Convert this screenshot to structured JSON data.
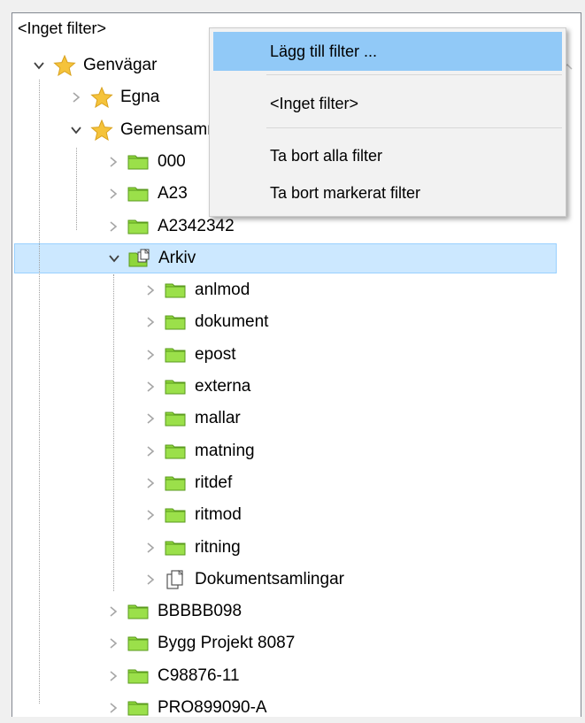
{
  "filter_label": "<Inget filter>",
  "tree": {
    "rows": [
      {
        "label": "Genvägar",
        "icon": "star-icon",
        "expanded": true
      },
      {
        "label": "Egna",
        "icon": "star-icon",
        "expanded": false
      },
      {
        "label": "Gemensamma",
        "icon": "star-icon",
        "expanded": true
      },
      {
        "label": "000",
        "icon": "folder-icon",
        "expanded": false
      },
      {
        "label": "A23",
        "icon": "folder-icon",
        "expanded": false
      },
      {
        "label": "A2342342",
        "icon": "folder-icon",
        "expanded": false
      },
      {
        "label": "Arkiv",
        "icon": "archive-folder-icon",
        "expanded": true,
        "selected": true
      },
      {
        "label": "anlmod",
        "icon": "folder-icon",
        "expanded": false
      },
      {
        "label": "dokument",
        "icon": "folder-icon",
        "expanded": false
      },
      {
        "label": "epost",
        "icon": "folder-icon",
        "expanded": false
      },
      {
        "label": "externa",
        "icon": "folder-icon",
        "expanded": false
      },
      {
        "label": "mallar",
        "icon": "folder-icon",
        "expanded": false
      },
      {
        "label": "matning",
        "icon": "folder-icon",
        "expanded": false
      },
      {
        "label": "ritdef",
        "icon": "folder-icon",
        "expanded": false
      },
      {
        "label": "ritmod",
        "icon": "folder-icon",
        "expanded": false
      },
      {
        "label": "ritning",
        "icon": "folder-icon",
        "expanded": false
      },
      {
        "label": "Dokumentsamlingar",
        "icon": "document-collection-icon",
        "expanded": false
      },
      {
        "label": "BBBBB098",
        "icon": "folder-icon",
        "expanded": false
      },
      {
        "label": "Bygg Projekt 8087",
        "icon": "folder-icon",
        "expanded": false
      },
      {
        "label": "C98876-11",
        "icon": "folder-icon",
        "expanded": false
      },
      {
        "label": "PRO899090-A",
        "icon": "folder-icon",
        "expanded": false
      }
    ]
  },
  "context_menu": {
    "items": [
      {
        "label": "Lägg till filter ...",
        "highlighted": true
      },
      {
        "label": "<Inget filter>"
      },
      {
        "label": "Ta bort alla filter"
      },
      {
        "label": "Ta bort markerat filter"
      }
    ]
  },
  "colors": {
    "selection_bg": "#cce8ff",
    "menu_highlight": "#91c9f7",
    "folder_green": "#8ed63b",
    "star_gold": "#f5c33b"
  }
}
